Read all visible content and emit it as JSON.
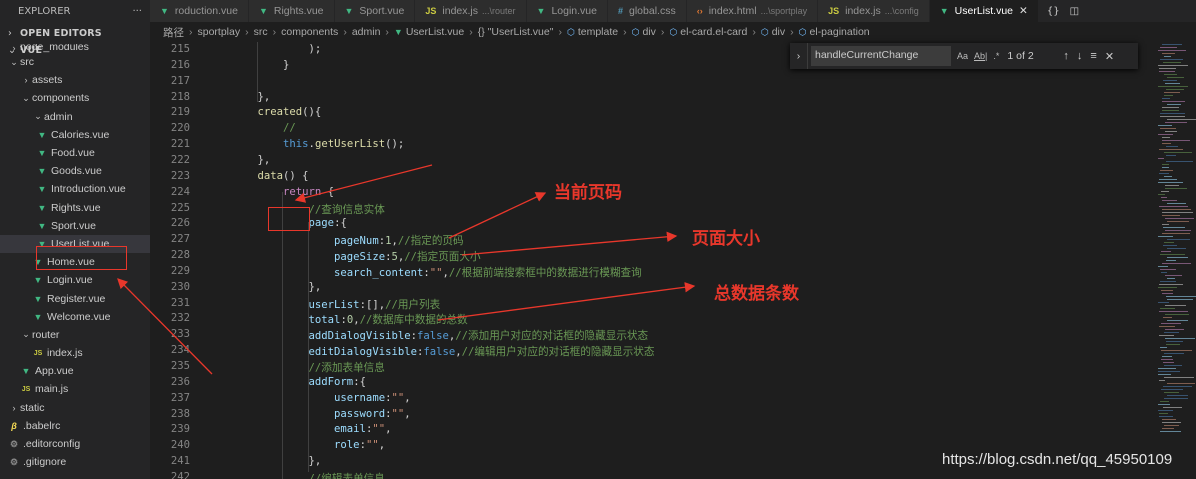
{
  "sidebar": {
    "title": "EXPLORER",
    "more": "···",
    "open_editors": "OPEN EDITORS",
    "workspace": "VUE",
    "tree": [
      {
        "label": "node_modules",
        "icon": "chevron-right",
        "level": 1,
        "type": "folder"
      },
      {
        "label": "src",
        "icon": "chevron-down",
        "level": 1,
        "type": "folder"
      },
      {
        "label": "assets",
        "icon": "chevron-right",
        "level": 2,
        "type": "folder"
      },
      {
        "label": "components",
        "icon": "chevron-down",
        "level": 2,
        "type": "folder"
      },
      {
        "label": "admin",
        "icon": "chevron-down",
        "level": 3,
        "type": "folder"
      },
      {
        "label": "Calories.vue",
        "icon": "vue-icon",
        "level": 4,
        "type": "file"
      },
      {
        "label": "Food.vue",
        "icon": "vue-icon",
        "level": 4,
        "type": "file"
      },
      {
        "label": "Goods.vue",
        "icon": "vue-icon",
        "level": 4,
        "type": "file"
      },
      {
        "label": "Introduction.vue",
        "icon": "vue-icon",
        "level": 4,
        "type": "file"
      },
      {
        "label": "Rights.vue",
        "icon": "vue-icon",
        "level": 4,
        "type": "file"
      },
      {
        "label": "Sport.vue",
        "icon": "vue-icon",
        "level": 4,
        "type": "file"
      },
      {
        "label": "UserList.vue",
        "icon": "vue-icon",
        "level": 4,
        "type": "file",
        "active": true
      },
      {
        "label": "Home.vue",
        "icon": "vue-icon",
        "level": 3,
        "type": "file"
      },
      {
        "label": "Login.vue",
        "icon": "vue-icon",
        "level": 3,
        "type": "file"
      },
      {
        "label": "Register.vue",
        "icon": "vue-icon",
        "level": 3,
        "type": "file"
      },
      {
        "label": "Welcome.vue",
        "icon": "vue-icon",
        "level": 3,
        "type": "file"
      },
      {
        "label": "router",
        "icon": "chevron-down",
        "level": 2,
        "type": "folder"
      },
      {
        "label": "index.js",
        "icon": "js-icon",
        "level": 3,
        "type": "file"
      },
      {
        "label": "App.vue",
        "icon": "vue-icon",
        "level": 2,
        "type": "file"
      },
      {
        "label": "main.js",
        "icon": "js-icon",
        "level": 2,
        "type": "file"
      },
      {
        "label": "static",
        "icon": "chevron-right",
        "level": 1,
        "type": "folder"
      },
      {
        "label": ".babelrc",
        "icon": "babel-icon",
        "level": 1,
        "type": "file"
      },
      {
        "label": ".editorconfig",
        "icon": "gear-icon",
        "level": 1,
        "type": "file"
      },
      {
        "label": ".gitignore",
        "icon": "gear-icon",
        "level": 1,
        "type": "file"
      }
    ]
  },
  "tabs": [
    {
      "label": "roduction.vue",
      "icon": "vue-icon",
      "sub": ""
    },
    {
      "label": "Rights.vue",
      "icon": "vue-icon",
      "sub": ""
    },
    {
      "label": "Sport.vue",
      "icon": "vue-icon",
      "sub": ""
    },
    {
      "label": "index.js",
      "icon": "js-icon",
      "sub": "...\\router"
    },
    {
      "label": "Login.vue",
      "icon": "vue-icon",
      "sub": ""
    },
    {
      "label": "global.css",
      "icon": "css-icon",
      "sub": ""
    },
    {
      "label": "index.html",
      "icon": "html-icon",
      "sub": "...\\sportplay"
    },
    {
      "label": "index.js",
      "icon": "js-icon",
      "sub": "...\\config"
    },
    {
      "label": "UserList.vue",
      "icon": "vue-icon",
      "sub": "",
      "active": true
    }
  ],
  "tab_actions": {
    "json": "{}",
    "split": "◫"
  },
  "breadcrumb": [
    "路径",
    "sportplay",
    "src",
    "components",
    "admin",
    "UserList.vue",
    "{} \"UserList.vue\"",
    "template",
    "div",
    "el-card.el-card",
    "div",
    "el-pagination"
  ],
  "find": {
    "query": "handleCurrentChange",
    "match_case": "Aa",
    "whole_word": "Ab|",
    "regex": ".*",
    "count": "1 of 2",
    "prev": "↑",
    "next": "↓",
    "selection": "≡",
    "close": "✕"
  },
  "lines": [
    {
      "n": "215",
      "tokens": [
        [
          "p",
          "            );"
        ]
      ]
    },
    {
      "n": "216",
      "tokens": [
        [
          "p",
          "        }"
        ]
      ]
    },
    {
      "n": "217",
      "tokens": []
    },
    {
      "n": "218",
      "tokens": [
        [
          "p",
          "    },"
        ]
      ]
    },
    {
      "n": "219",
      "tokens": [
        [
          "f",
          "    created"
        ],
        [
          "p",
          "(){"
        ]
      ]
    },
    {
      "n": "220",
      "tokens": [
        [
          "c",
          "        //"
        ]
      ]
    },
    {
      "n": "221",
      "tokens": [
        [
          "k",
          "        this"
        ],
        [
          "p",
          "."
        ],
        [
          "f",
          "getUserList"
        ],
        [
          "p",
          "();"
        ]
      ]
    },
    {
      "n": "222",
      "tokens": [
        [
          "p",
          "    },"
        ]
      ]
    },
    {
      "n": "223",
      "tokens": [
        [
          "f",
          "    data"
        ],
        [
          "p",
          "() {"
        ]
      ]
    },
    {
      "n": "224",
      "tokens": [
        [
          "kw",
          "        return"
        ],
        [
          "p",
          " {"
        ]
      ]
    },
    {
      "n": "225",
      "tokens": [
        [
          "c",
          "            //查询信息实体"
        ]
      ]
    },
    {
      "n": "226",
      "tokens": [
        [
          "v",
          "            page"
        ],
        [
          "p",
          ":{"
        ]
      ]
    },
    {
      "n": "227",
      "tokens": [
        [
          "v",
          "                pageNum"
        ],
        [
          "p",
          ":"
        ],
        [
          "n",
          "1"
        ],
        [
          "p",
          ","
        ],
        [
          "c",
          "//指定的页码"
        ]
      ]
    },
    {
      "n": "228",
      "tokens": [
        [
          "v",
          "                pageSize"
        ],
        [
          "p",
          ":"
        ],
        [
          "n",
          "5"
        ],
        [
          "p",
          ","
        ],
        [
          "c",
          "//指定页面大小"
        ]
      ]
    },
    {
      "n": "229",
      "tokens": [
        [
          "v",
          "                search_content"
        ],
        [
          "p",
          ":"
        ],
        [
          "s",
          "\"\""
        ],
        [
          "p",
          ","
        ],
        [
          "c",
          "//根据前端搜索框中的数据进行模糊查询"
        ]
      ]
    },
    {
      "n": "230",
      "tokens": [
        [
          "p",
          "            },"
        ]
      ]
    },
    {
      "n": "231",
      "tokens": [
        [
          "v",
          "            userList"
        ],
        [
          "p",
          ":[],"
        ],
        [
          "c",
          "//用户列表"
        ]
      ]
    },
    {
      "n": "232",
      "tokens": [
        [
          "v",
          "            total"
        ],
        [
          "p",
          ":"
        ],
        [
          "n",
          "0"
        ],
        [
          "p",
          ","
        ],
        [
          "c",
          "//数据库中数据的总数"
        ]
      ]
    },
    {
      "n": "233",
      "tokens": [
        [
          "v",
          "            addDialogVisible"
        ],
        [
          "p",
          ":"
        ],
        [
          "k",
          "false"
        ],
        [
          "p",
          ","
        ],
        [
          "c",
          "//添加用户对应的对话框的隐藏显示状态"
        ]
      ]
    },
    {
      "n": "234",
      "tokens": [
        [
          "v",
          "            editDialogVisible"
        ],
        [
          "p",
          ":"
        ],
        [
          "k",
          "false"
        ],
        [
          "p",
          ","
        ],
        [
          "c",
          "//编辑用户对应的对话框的隐藏显示状态"
        ]
      ]
    },
    {
      "n": "235",
      "tokens": [
        [
          "c",
          "            //添加表单信息"
        ]
      ]
    },
    {
      "n": "236",
      "tokens": [
        [
          "v",
          "            addForm"
        ],
        [
          "p",
          ":{"
        ]
      ]
    },
    {
      "n": "237",
      "tokens": [
        [
          "v",
          "                username"
        ],
        [
          "p",
          ":"
        ],
        [
          "s",
          "\"\""
        ],
        [
          "p",
          ","
        ]
      ]
    },
    {
      "n": "238",
      "tokens": [
        [
          "v",
          "                password"
        ],
        [
          "p",
          ":"
        ],
        [
          "s",
          "\"\""
        ],
        [
          "p",
          ","
        ]
      ]
    },
    {
      "n": "239",
      "tokens": [
        [
          "v",
          "                email"
        ],
        [
          "p",
          ":"
        ],
        [
          "s",
          "\"\""
        ],
        [
          "p",
          ","
        ]
      ]
    },
    {
      "n": "240",
      "tokens": [
        [
          "v",
          "                role"
        ],
        [
          "p",
          ":"
        ],
        [
          "s",
          "\"\""
        ],
        [
          "p",
          ","
        ]
      ]
    },
    {
      "n": "241",
      "tokens": [
        [
          "p",
          "            },"
        ]
      ]
    },
    {
      "n": "242",
      "tokens": [
        [
          "c",
          "            //编辑表单信息"
        ]
      ]
    }
  ],
  "annotations": {
    "current_page": "当前页码",
    "page_size": "页面大小",
    "total_count": "总数据条数",
    "color": "#e8372b"
  },
  "watermark": "https://blog.csdn.net/qq_45950109",
  "colors": {
    "editor_bg": "#1e1e1e",
    "sidebar_bg": "#252526",
    "vue_green": "#41b883",
    "comment": "#6a9955"
  }
}
